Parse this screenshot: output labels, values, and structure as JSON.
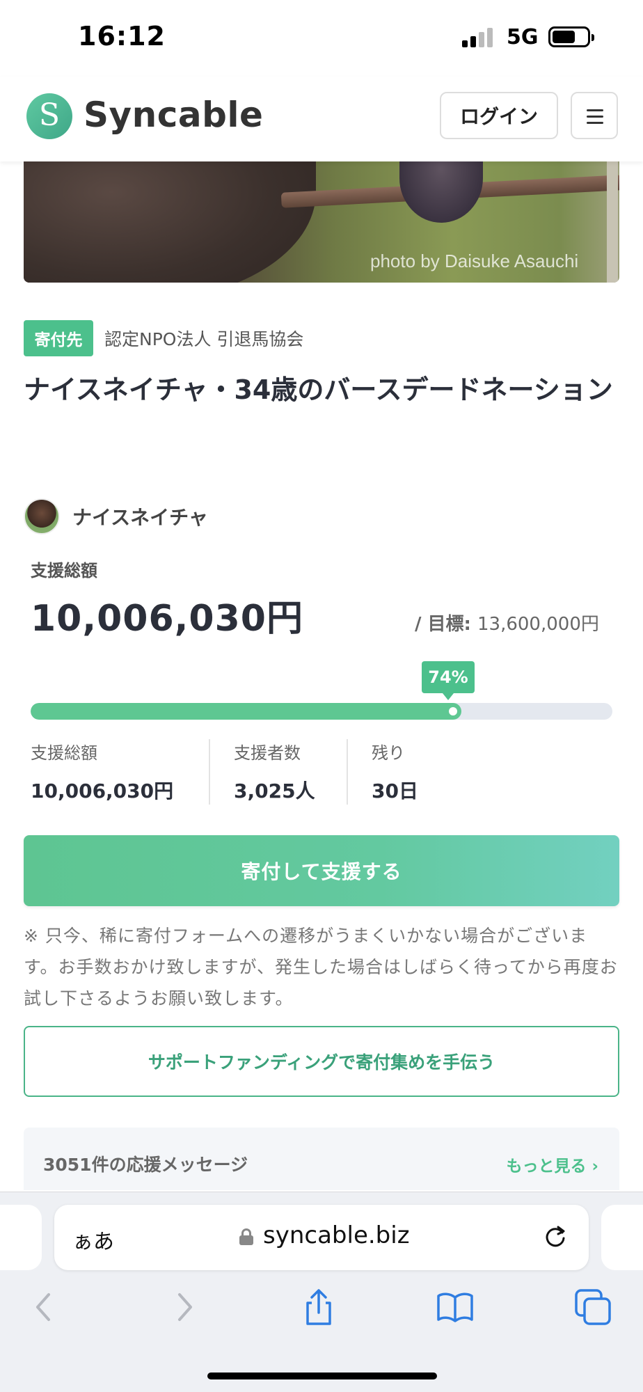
{
  "status_bar": {
    "time": "16:12",
    "network": "5G",
    "battery_level": 0.6
  },
  "header": {
    "logo_text": "Syncable",
    "logo_glyph": "S",
    "login_label": "ログイン"
  },
  "hero": {
    "credit": "photo by Daisuke Asauchi"
  },
  "project": {
    "tag": "寄付先",
    "organization": "認定NPO法人 引退馬協会",
    "title": "ナイスネイチャ・34歳のバースデードネーション",
    "owner_name": "ナイスネイチャ"
  },
  "funding": {
    "total_label": "支援総額",
    "total_amount": "10,006,030円",
    "goal_prefix": "/ 目標: ",
    "goal_amount": "13,600,000円",
    "percent_label": "74%",
    "percent": 0.74
  },
  "stats": [
    {
      "label": "支援総額",
      "value": "10,006,030円"
    },
    {
      "label": "支援者数",
      "value": "3,025人"
    },
    {
      "label": "残り",
      "value": "30日"
    }
  ],
  "actions": {
    "donate_label": "寄付して支援する",
    "notice": "※ 只今、稀に寄付フォームへの遷移がうまくいかない場合がございます。お手数おかけ致しますが、発生した場合はしばらく待ってから再度お試し下さるようお願い致します。",
    "support_funding_label": "サポートファンディングで寄付集めを手伝う"
  },
  "messages": {
    "heading": "3051件の応援メッセージ",
    "more_label": "もっと見る ›"
  },
  "browser": {
    "aa_label": "ぁあ",
    "domain": "syncable.biz"
  },
  "colors": {
    "brand_green": "#4cc08c",
    "progress_fill": "#5ec792",
    "track": "#e4e8ef"
  },
  "icons": [
    "signal-icon",
    "battery-icon",
    "hamburger-menu-icon",
    "lock-icon",
    "reload-icon",
    "back-icon",
    "forward-icon",
    "share-icon",
    "bookmarks-icon",
    "tabs-icon"
  ]
}
